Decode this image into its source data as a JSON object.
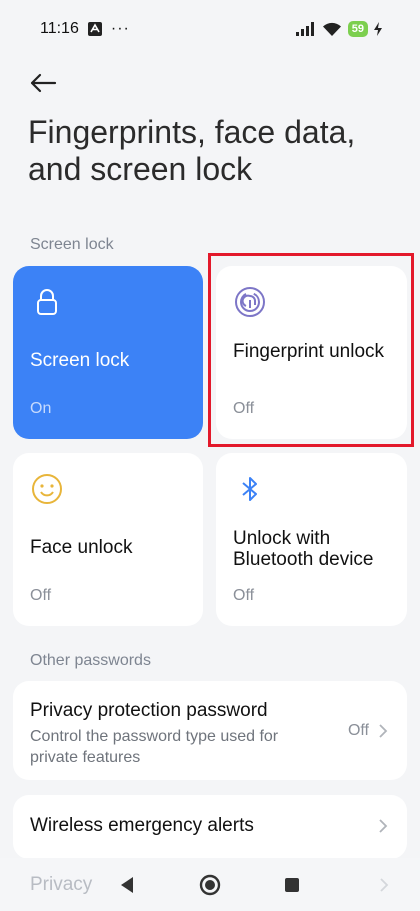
{
  "status_bar": {
    "time": "11:16",
    "overflow": "···",
    "battery": "59",
    "icons": [
      "notification-icon",
      "signal-icon",
      "wifi-icon",
      "battery-icon",
      "charging-icon"
    ]
  },
  "header": {
    "title": "Fingerprints, face data, and screen lock"
  },
  "sections": {
    "screen_lock": "Screen lock",
    "other_passwords": "Other passwords"
  },
  "cards": [
    {
      "title": "Screen lock",
      "status": "On",
      "icon": "lock-icon",
      "active": true
    },
    {
      "title": "Fingerprint unlock",
      "status": "Off",
      "icon": "fingerprint-icon",
      "active": false
    },
    {
      "title": "Face unlock",
      "status": "Off",
      "icon": "face-icon",
      "active": false
    },
    {
      "title": "Unlock with Bluetooth device",
      "status": "Off",
      "icon": "bluetooth-icon",
      "active": false
    }
  ],
  "list": [
    {
      "title": "Privacy protection password",
      "desc": "Control the password type used for private features",
      "value": "Off"
    },
    {
      "title": "Wireless emergency alerts",
      "desc": "",
      "value": ""
    }
  ],
  "footer": {
    "partial_item": "Privacy"
  },
  "colors": {
    "accent": "#3c82f6",
    "highlight": "#e3192b",
    "face_icon": "#e8b53a",
    "fingerprint_icon": "#7d76c7"
  }
}
